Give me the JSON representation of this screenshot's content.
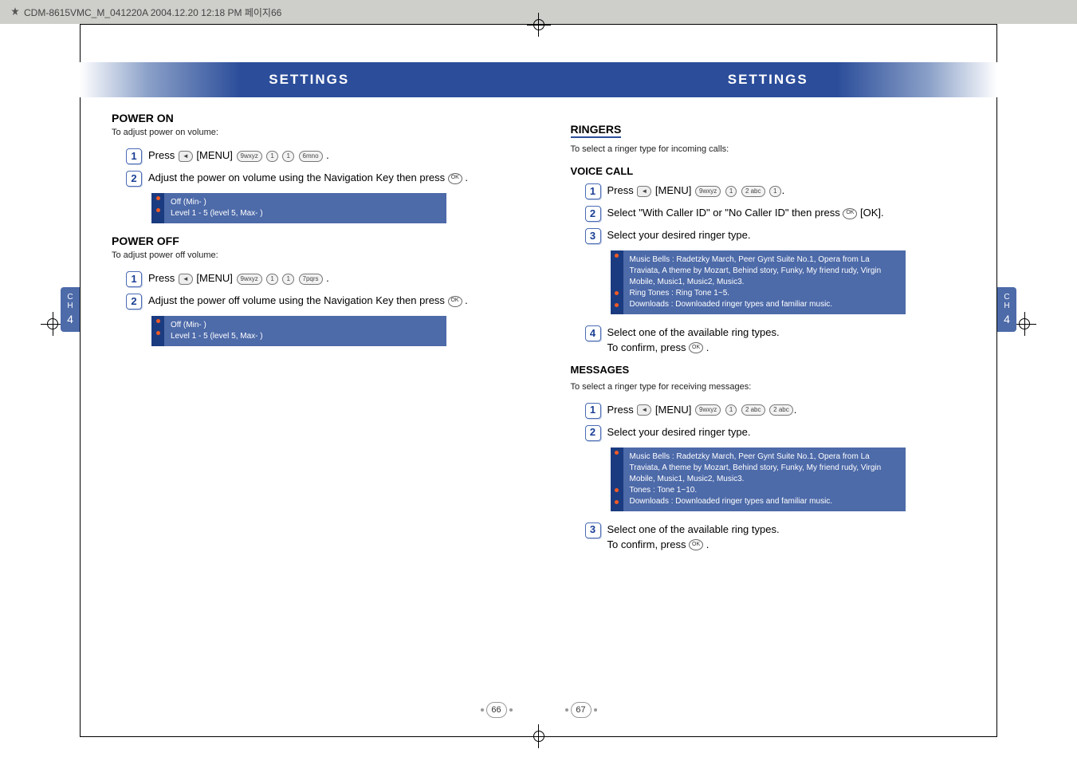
{
  "header": {
    "file_stamp": "CDM-8615VMC_M_041220A  2004.12.20 12:18 PM  페이지66"
  },
  "left_page": {
    "band_title": "SETTINGS",
    "chapter_tab": {
      "line1": "C",
      "line2": "H",
      "num": "4"
    },
    "page_number": "66",
    "sections": [
      {
        "heading": "POWER ON",
        "desc": "To adjust power on volume:",
        "steps": [
          {
            "num": "1",
            "text_parts": [
              "Press ",
              " [MENU] ",
              " ",
              " ",
              " ",
              " ."
            ]
          },
          {
            "num": "2",
            "text_parts": [
              "Adjust the power on volume using the Navigation Key then press ",
              " ."
            ]
          }
        ],
        "info_bullets": [
          "Off (Min-      )",
          "Level 1 - 5 (level 5, Max-      )"
        ]
      },
      {
        "heading": "POWER OFF",
        "desc": "To adjust power off volume:",
        "steps": [
          {
            "num": "1",
            "text_parts": [
              "Press ",
              " [MENU] ",
              " ",
              " ",
              " ",
              " ."
            ]
          },
          {
            "num": "2",
            "text_parts": [
              "Adjust the power off volume using the Navigation Key then press ",
              " ."
            ]
          }
        ],
        "info_bullets": [
          "Off (Min-      )",
          "Level 1 - 5 (level 5, Max-      )"
        ]
      }
    ]
  },
  "right_page": {
    "band_title": "SETTINGS",
    "chapter_tab": {
      "line1": "C",
      "line2": "H",
      "num": "4"
    },
    "page_number": "67",
    "section_heading": "RINGERS",
    "section_desc": "To select a ringer type for incoming calls:",
    "subsections": [
      {
        "subhead": "VOICE CALL",
        "steps": [
          {
            "num": "1",
            "text": "Press      [MENU]                         ."
          },
          {
            "num": "2",
            "text": "Select \"With Caller ID\" or \"No Caller ID\" then press       [OK]."
          },
          {
            "num": "3",
            "text": "Select your desired ringer type."
          }
        ],
        "info_bullets": [
          "Music Bells : Radetzky March, Peer Gynt Suite No.1, Opera from La Traviata, A theme by Mozart, Behind story, Funky, My friend rudy, Virgin Mobile, Music1, Music2, Music3.",
          "Ring Tones : Ring Tone 1~5.",
          "Downloads : Downloaded ringer types and familiar music."
        ],
        "step4": {
          "num": "4",
          "text": "Select one of the available ring types. To confirm, press       ."
        }
      },
      {
        "subhead": "MESSAGES",
        "desc": "To select a ringer type for receiving messages:",
        "steps": [
          {
            "num": "1",
            "text": "Press      [MENU]                         ."
          },
          {
            "num": "2",
            "text": "Select your desired ringer type."
          }
        ],
        "info_bullets": [
          "Music Bells : Radetzky March, Peer Gynt Suite No.1, Opera from La Traviata, A theme by Mozart, Behind story, Funky, My friend rudy, Virgin Mobile, Music1, Music2, Music3.",
          "Tones : Tone 1~10.",
          "Downloads : Downloaded ringer types and familiar music."
        ],
        "step3": {
          "num": "3",
          "text": "Select one of the available ring types. To confirm, press       ."
        }
      }
    ]
  },
  "keys": {
    "menu_soft": "◄",
    "nine": "9wxyz",
    "one_a": "1 ",
    "one_b": "1 ",
    "six": "6mno",
    "seven": "7pqrs",
    "two": "2 abc",
    "ok": "OK"
  }
}
